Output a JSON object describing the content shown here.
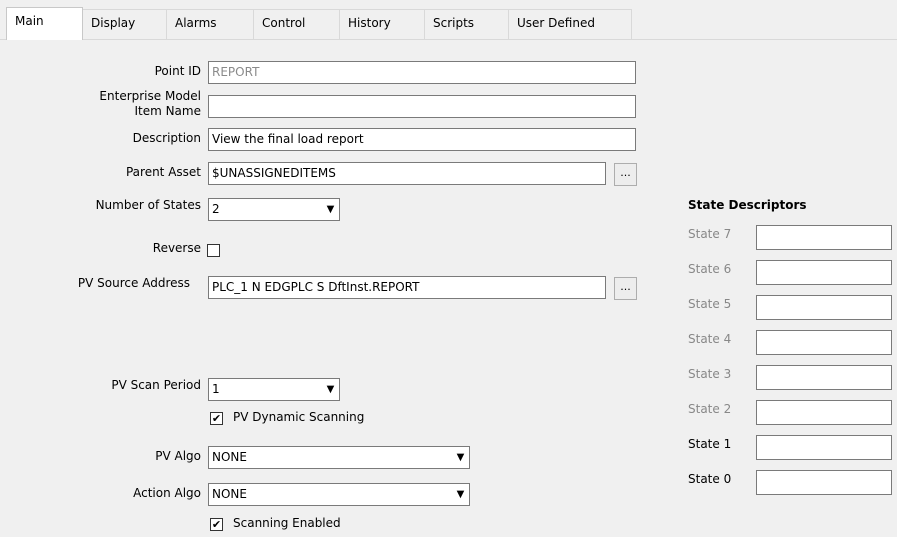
{
  "tabs": [
    {
      "label": "Main",
      "active": true
    },
    {
      "label": "Display"
    },
    {
      "label": "Alarms"
    },
    {
      "label": "Control"
    },
    {
      "label": "History"
    },
    {
      "label": "Scripts"
    },
    {
      "label": "User Defined"
    }
  ],
  "main": {
    "point_id": {
      "label": "Point ID",
      "value": "REPORT"
    },
    "enterprise_model": {
      "label_line1": "Enterprise Model",
      "label_line2": "Item Name",
      "value": ""
    },
    "description": {
      "label": "Description",
      "value": "View the final load report"
    },
    "parent_asset": {
      "label": "Parent Asset",
      "value": "$UNASSIGNEDITEMS",
      "browse_label": "..."
    },
    "number_of_states": {
      "label": "Number of States",
      "value": "2"
    },
    "reverse": {
      "label": "Reverse",
      "checked": false
    },
    "pv_source_address": {
      "label": "PV Source Address",
      "value": "PLC_1 N EDGPLC S DftInst.REPORT",
      "browse_label": "..."
    },
    "pv_scan_period": {
      "label": "PV Scan Period",
      "value": "1"
    },
    "pv_dynamic_scanning": {
      "label": "PV Dynamic Scanning",
      "checked": true
    },
    "pv_algo": {
      "label": "PV Algo",
      "value": "NONE"
    },
    "action_algo": {
      "label": "Action Algo",
      "value": "NONE"
    },
    "scanning_enabled": {
      "label": "Scanning Enabled",
      "checked": true
    }
  },
  "state_descriptors": {
    "title": "State Descriptors",
    "states": [
      {
        "label": "State 7",
        "value": "",
        "enabled": false
      },
      {
        "label": "State 6",
        "value": "",
        "enabled": false
      },
      {
        "label": "State 5",
        "value": "",
        "enabled": false
      },
      {
        "label": "State 4",
        "value": "",
        "enabled": false
      },
      {
        "label": "State 3",
        "value": "",
        "enabled": false
      },
      {
        "label": "State 2",
        "value": "",
        "enabled": false
      },
      {
        "label": "State 1",
        "value": "",
        "enabled": true
      },
      {
        "label": "State 0",
        "value": "",
        "enabled": true
      }
    ]
  },
  "icons": {
    "dropdown": "▼",
    "check": "✔"
  }
}
